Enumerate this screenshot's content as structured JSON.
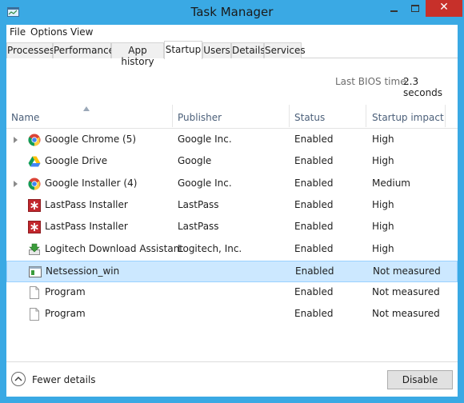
{
  "window": {
    "title": "Task Manager"
  },
  "menu": [
    "File",
    "Options",
    "View"
  ],
  "tabs": [
    {
      "label": "Processes"
    },
    {
      "label": "Performance"
    },
    {
      "label": "App history"
    },
    {
      "label": "Startup",
      "active": true
    },
    {
      "label": "Users"
    },
    {
      "label": "Details"
    },
    {
      "label": "Services"
    }
  ],
  "bios": {
    "label": "Last BIOS time:",
    "value": "2.3 seconds"
  },
  "columns": {
    "name": "Name",
    "publisher": "Publisher",
    "status": "Status",
    "impact": "Startup impact"
  },
  "rows": [
    {
      "name": "Google Chrome (5)",
      "publisher": "Google Inc.",
      "status": "Enabled",
      "impact": "High",
      "icon": "chrome-icon",
      "expandable": true
    },
    {
      "name": "Google Drive",
      "publisher": "Google",
      "status": "Enabled",
      "impact": "High",
      "icon": "google-drive-icon",
      "expandable": false
    },
    {
      "name": "Google Installer (4)",
      "publisher": "Google Inc.",
      "status": "Enabled",
      "impact": "Medium",
      "icon": "google-installer-icon",
      "expandable": true
    },
    {
      "name": "LastPass Installer",
      "publisher": "LastPass",
      "status": "Enabled",
      "impact": "High",
      "icon": "lastpass-icon",
      "expandable": false
    },
    {
      "name": "LastPass Installer",
      "publisher": "LastPass",
      "status": "Enabled",
      "impact": "High",
      "icon": "lastpass-icon",
      "expandable": false
    },
    {
      "name": "Logitech Download Assistant",
      "publisher": "Logitech, Inc.",
      "status": "Enabled",
      "impact": "High",
      "icon": "installer-download-icon",
      "expandable": false
    },
    {
      "name": "Netsession_win",
      "publisher": "",
      "status": "Enabled",
      "impact": "Not measured",
      "icon": "app-window-icon",
      "expandable": false,
      "selected": true
    },
    {
      "name": "Program",
      "publisher": "",
      "status": "Enabled",
      "impact": "Not measured",
      "icon": "blank-file-icon",
      "expandable": false
    },
    {
      "name": "Program",
      "publisher": "",
      "status": "Enabled",
      "impact": "Not measured",
      "icon": "blank-file-icon",
      "expandable": false
    }
  ],
  "footer": {
    "fewer_details": "Fewer details",
    "disable": "Disable"
  },
  "colors": {
    "frame": "#3aa9e4",
    "close": "#c7302a",
    "selection": "#cce8ff",
    "header_text": "#4c607a"
  }
}
